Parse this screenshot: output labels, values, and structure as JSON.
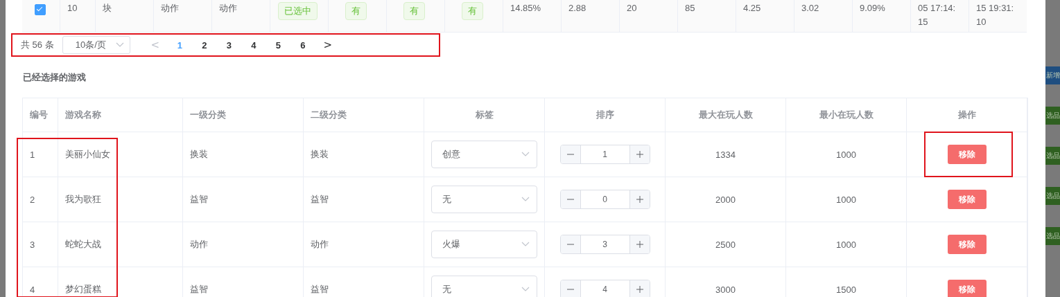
{
  "top_row": {
    "checked": true,
    "cells": [
      "10",
      "块",
      "动作",
      "动作"
    ],
    "tags": [
      {
        "text": "已选中"
      },
      {
        "text": "有"
      },
      {
        "text": "有"
      },
      {
        "text": "有"
      }
    ],
    "stats": [
      "14.85%",
      "2.88",
      "20",
      "85",
      "4.25",
      "3.02",
      "9.09%",
      "05 17:14:15",
      "15 19:31:10"
    ]
  },
  "pagination": {
    "total": "共 56 条",
    "page_size": "10条/页",
    "prev": "<",
    "next": ">",
    "pages": [
      {
        "label": "1",
        "selected": true
      },
      {
        "label": "2",
        "selected": false
      },
      {
        "label": "3",
        "selected": false
      },
      {
        "label": "4",
        "selected": false
      },
      {
        "label": "5",
        "selected": false
      },
      {
        "label": "6",
        "selected": false
      }
    ]
  },
  "section_title": "已经选择的游戏",
  "table": {
    "columns": [
      "编号",
      "游戏名称",
      "一级分类",
      "二级分类",
      "标签",
      "排序",
      "最大在玩人数",
      "最小在玩人数",
      "操作"
    ],
    "rows": [
      {
        "id": "1",
        "name": "美丽小仙女",
        "category1": "换装",
        "category2": "换装",
        "tag": "创意",
        "order": "1",
        "max_players": "1334",
        "min_players": "1000",
        "action": "移除"
      },
      {
        "id": "2",
        "name": "我为歌狂",
        "category1": "益智",
        "category2": "益智",
        "tag": "无",
        "order": "0",
        "max_players": "2000",
        "min_players": "1000",
        "action": "移除"
      },
      {
        "id": "3",
        "name": "蛇蛇大战",
        "category1": "动作",
        "category2": "动作",
        "tag": "火爆",
        "order": "3",
        "max_players": "2500",
        "min_players": "1000",
        "action": "移除"
      },
      {
        "id": "4",
        "name": "梦幻蛋糕",
        "category1": "益智",
        "category2": "益智",
        "tag": "无",
        "order": "4",
        "max_players": "3000",
        "min_players": "1500",
        "action": "移除"
      }
    ]
  },
  "background_buttons": [
    {
      "kind": "primary",
      "label": "新增"
    },
    {
      "kind": "success",
      "label": "选品"
    },
    {
      "kind": "success",
      "label": "选品"
    },
    {
      "kind": "success",
      "label": "选品"
    },
    {
      "kind": "success",
      "label": "选品"
    }
  ]
}
